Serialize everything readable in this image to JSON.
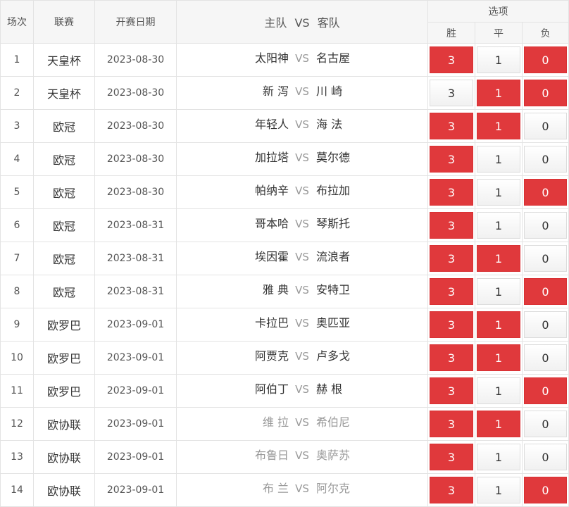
{
  "header": {
    "idx": "场次",
    "league": "联赛",
    "date": "开赛日期",
    "home": "主队",
    "vs": "VS",
    "away": "客队",
    "options": "选项",
    "win": "胜",
    "draw": "平",
    "lose": "负"
  },
  "colors": {
    "selected": "#e0393c",
    "unselected": "#f4f4f4"
  },
  "rows": [
    {
      "idx": "1",
      "league": "天皇杯",
      "date": "2023-08-30",
      "home": "太阳神",
      "vs": "VS",
      "away": "名古屋",
      "faded": false,
      "w": {
        "v": "3",
        "sel": true
      },
      "d": {
        "v": "1",
        "sel": false
      },
      "l": {
        "v": "0",
        "sel": true
      }
    },
    {
      "idx": "2",
      "league": "天皇杯",
      "date": "2023-08-30",
      "home": "新 泻",
      "vs": "VS",
      "away": "川 崎",
      "faded": false,
      "w": {
        "v": "3",
        "sel": false
      },
      "d": {
        "v": "1",
        "sel": true
      },
      "l": {
        "v": "0",
        "sel": true
      }
    },
    {
      "idx": "3",
      "league": "欧冠",
      "date": "2023-08-30",
      "home": "年轻人",
      "vs": "VS",
      "away": "海 法",
      "faded": false,
      "w": {
        "v": "3",
        "sel": true
      },
      "d": {
        "v": "1",
        "sel": true
      },
      "l": {
        "v": "0",
        "sel": false
      }
    },
    {
      "idx": "4",
      "league": "欧冠",
      "date": "2023-08-30",
      "home": "加拉塔",
      "vs": "VS",
      "away": "莫尔德",
      "faded": false,
      "w": {
        "v": "3",
        "sel": true
      },
      "d": {
        "v": "1",
        "sel": false
      },
      "l": {
        "v": "0",
        "sel": false
      }
    },
    {
      "idx": "5",
      "league": "欧冠",
      "date": "2023-08-30",
      "home": "帕纳辛",
      "vs": "VS",
      "away": "布拉加",
      "faded": false,
      "w": {
        "v": "3",
        "sel": true
      },
      "d": {
        "v": "1",
        "sel": false
      },
      "l": {
        "v": "0",
        "sel": true
      }
    },
    {
      "idx": "6",
      "league": "欧冠",
      "date": "2023-08-31",
      "home": "哥本哈",
      "vs": "VS",
      "away": "琴斯托",
      "faded": false,
      "w": {
        "v": "3",
        "sel": true
      },
      "d": {
        "v": "1",
        "sel": false
      },
      "l": {
        "v": "0",
        "sel": false
      }
    },
    {
      "idx": "7",
      "league": "欧冠",
      "date": "2023-08-31",
      "home": "埃因霍",
      "vs": "VS",
      "away": "流浪者",
      "faded": false,
      "w": {
        "v": "3",
        "sel": true
      },
      "d": {
        "v": "1",
        "sel": true
      },
      "l": {
        "v": "0",
        "sel": false
      }
    },
    {
      "idx": "8",
      "league": "欧冠",
      "date": "2023-08-31",
      "home": "雅 典",
      "vs": "VS",
      "away": "安特卫",
      "faded": false,
      "w": {
        "v": "3",
        "sel": true
      },
      "d": {
        "v": "1",
        "sel": false
      },
      "l": {
        "v": "0",
        "sel": true
      }
    },
    {
      "idx": "9",
      "league": "欧罗巴",
      "date": "2023-09-01",
      "home": "卡拉巴",
      "vs": "VS",
      "away": "奥匹亚",
      "faded": false,
      "w": {
        "v": "3",
        "sel": true
      },
      "d": {
        "v": "1",
        "sel": true
      },
      "l": {
        "v": "0",
        "sel": false
      }
    },
    {
      "idx": "10",
      "league": "欧罗巴",
      "date": "2023-09-01",
      "home": "阿贾克",
      "vs": "VS",
      "away": "卢多戈",
      "faded": false,
      "w": {
        "v": "3",
        "sel": true
      },
      "d": {
        "v": "1",
        "sel": true
      },
      "l": {
        "v": "0",
        "sel": false
      }
    },
    {
      "idx": "11",
      "league": "欧罗巴",
      "date": "2023-09-01",
      "home": "阿伯丁",
      "vs": "VS",
      "away": "赫 根",
      "faded": false,
      "w": {
        "v": "3",
        "sel": true
      },
      "d": {
        "v": "1",
        "sel": false
      },
      "l": {
        "v": "0",
        "sel": true
      }
    },
    {
      "idx": "12",
      "league": "欧协联",
      "date": "2023-09-01",
      "home": "维 拉",
      "vs": "VS",
      "away": "希伯尼",
      "faded": true,
      "w": {
        "v": "3",
        "sel": true
      },
      "d": {
        "v": "1",
        "sel": true
      },
      "l": {
        "v": "0",
        "sel": false
      }
    },
    {
      "idx": "13",
      "league": "欧协联",
      "date": "2023-09-01",
      "home": "布鲁日",
      "vs": "VS",
      "away": "奥萨苏",
      "faded": true,
      "w": {
        "v": "3",
        "sel": true
      },
      "d": {
        "v": "1",
        "sel": false
      },
      "l": {
        "v": "0",
        "sel": false
      }
    },
    {
      "idx": "14",
      "league": "欧协联",
      "date": "2023-09-01",
      "home": "布 兰",
      "vs": "VS",
      "away": "阿尔克",
      "faded": true,
      "w": {
        "v": "3",
        "sel": true
      },
      "d": {
        "v": "1",
        "sel": false
      },
      "l": {
        "v": "0",
        "sel": true
      }
    }
  ]
}
